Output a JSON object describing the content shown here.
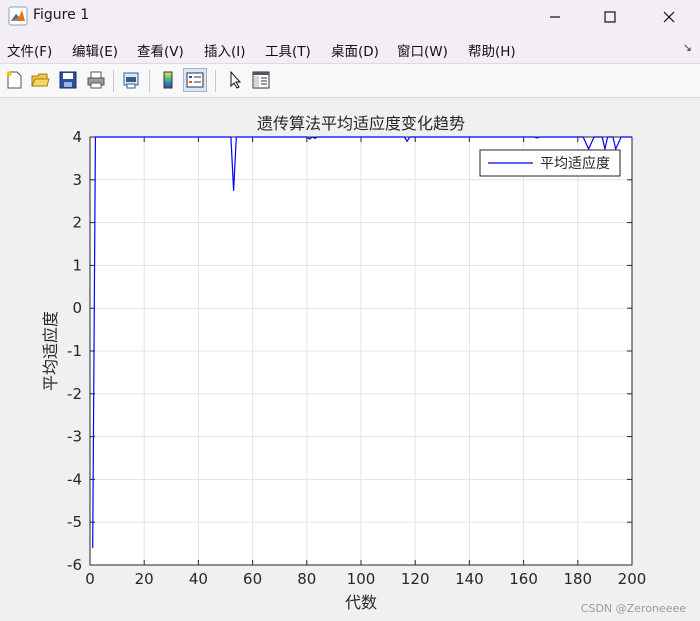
{
  "window": {
    "title": "Figure 1",
    "controls": {
      "minimize": "—",
      "maximize": "☐",
      "close": "✕"
    }
  },
  "menu": {
    "items": [
      {
        "label": "文件(F)",
        "name": "menu-file"
      },
      {
        "label": "编辑(E)",
        "name": "menu-edit"
      },
      {
        "label": "查看(V)",
        "name": "menu-view"
      },
      {
        "label": "插入(I)",
        "name": "menu-insert"
      },
      {
        "label": "工具(T)",
        "name": "menu-tools"
      },
      {
        "label": "桌面(D)",
        "name": "menu-desktop"
      },
      {
        "label": "窗口(W)",
        "name": "menu-window"
      },
      {
        "label": "帮助(H)",
        "name": "menu-help"
      }
    ],
    "dock_arrow": "↘"
  },
  "toolbar": {
    "buttons": [
      "new-figure-icon",
      "open-folder-icon",
      "save-icon",
      "print-icon",
      "print-preview-icon",
      "colorbar-icon",
      "legend-icon",
      "pointer-icon",
      "property-editor-icon"
    ]
  },
  "colors": {
    "series": "#0000ff",
    "grid": "#e3e3e3",
    "axes": "#262626"
  },
  "watermark": "CSDN @Zeroneeee",
  "chart_data": {
    "type": "line",
    "title": "遗传算法平均适应度变化趋势",
    "xlabel": "代数",
    "ylabel": "平均适应度",
    "xlim": [
      0,
      200
    ],
    "ylim": [
      -6,
      4
    ],
    "xticks": [
      0,
      20,
      40,
      60,
      80,
      100,
      120,
      140,
      160,
      180,
      200
    ],
    "yticks": [
      -6,
      -5,
      -4,
      -3,
      -2,
      -1,
      0,
      1,
      2,
      3,
      4
    ],
    "grid": true,
    "legend": {
      "position": "top-right",
      "entries": [
        "平均适应度"
      ]
    },
    "series": [
      {
        "name": "平均适应度",
        "x": [
          1,
          2,
          3,
          50,
          52,
          53,
          54,
          56,
          80,
          81,
          82,
          83,
          84,
          116,
          117,
          118,
          119,
          164,
          165,
          166,
          182,
          184,
          186,
          189,
          190,
          191,
          193,
          194,
          196,
          200
        ],
        "y": [
          -5.6,
          4.0,
          4.0,
          4.0,
          4.0,
          2.75,
          4.0,
          4.0,
          4.0,
          3.95,
          4.0,
          3.97,
          4.0,
          4.0,
          3.9,
          4.0,
          4.0,
          4.0,
          3.98,
          4.0,
          4.0,
          3.72,
          4.0,
          4.0,
          3.72,
          4.0,
          4.0,
          3.72,
          4.0,
          4.0
        ]
      }
    ]
  }
}
